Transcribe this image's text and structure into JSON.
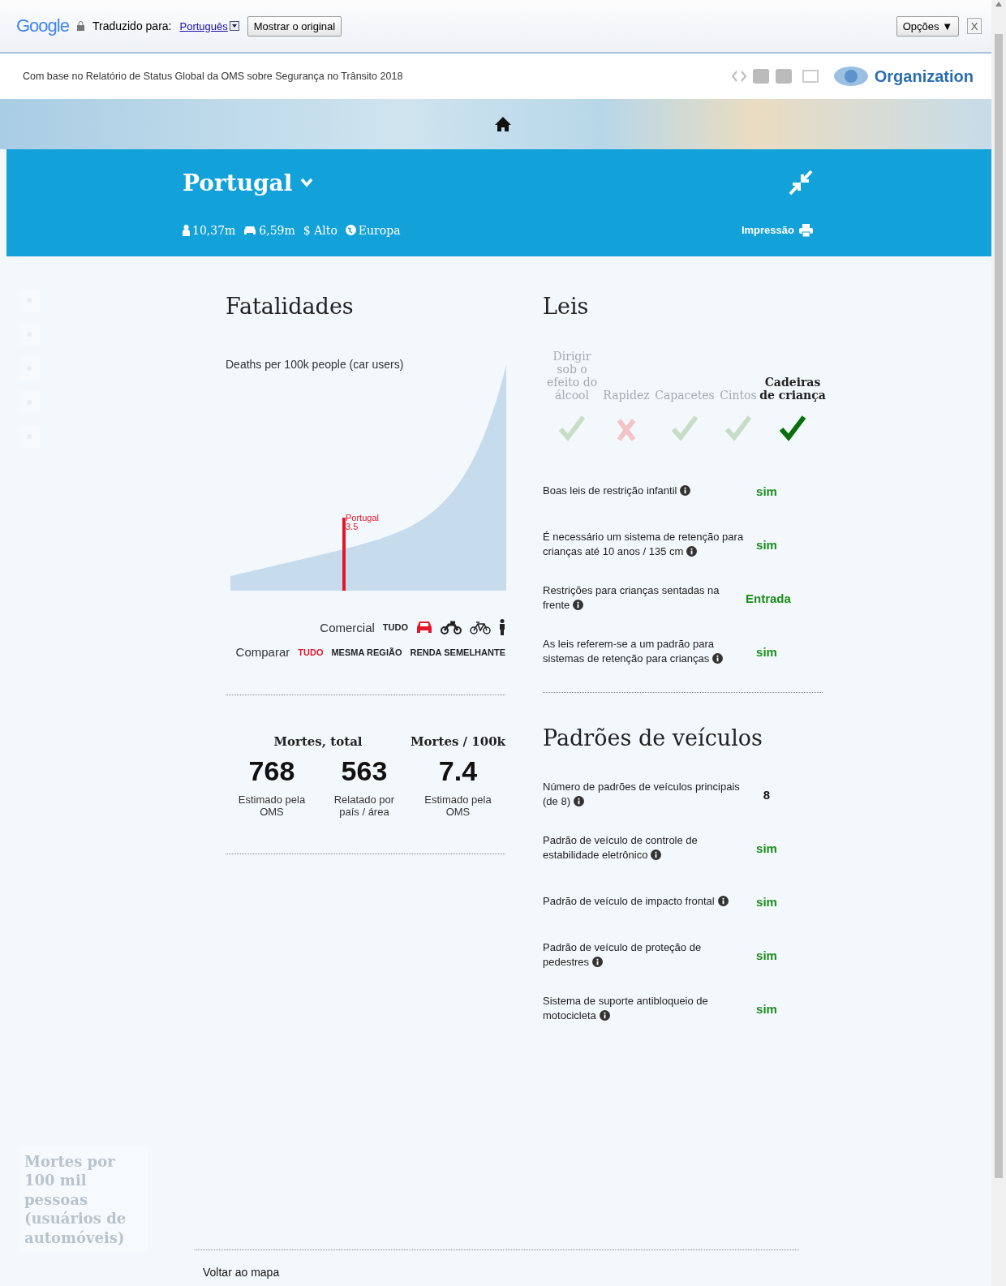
{
  "translate_bar": {
    "logo": "Google",
    "translated_label": "Traduzido para:",
    "language": "Português",
    "show_original_button": "Mostrar o original",
    "options_button": "Opções ▼",
    "close_button": "X"
  },
  "site_header": {
    "source_note": "Com base no Relatório de Status Global da OMS sobre Segurança no Trânsito 2018",
    "org_name": "Organization"
  },
  "country_bar": {
    "country": "Portugal",
    "stats": [
      {
        "kind": "population",
        "text": "10,37m"
      },
      {
        "kind": "vehicles",
        "text": "6,59m"
      },
      {
        "kind": "income",
        "text": "$ Alto"
      },
      {
        "kind": "region",
        "text": "Europa"
      }
    ],
    "print_label": "Impressão"
  },
  "legend": {
    "title": "Mortes por 100 mil pessoas (usuários de automóveis)"
  },
  "fatalities": {
    "title": "Fatalidades",
    "chart_title": "Deaths per 100k people (car users)",
    "marker_label": "Portugal",
    "marker_value": "3.5",
    "mode_label": "Comercial",
    "modes": [
      {
        "kind": "all",
        "label": "TUDO",
        "selected": false
      },
      {
        "kind": "car",
        "selected": true
      },
      {
        "kind": "motorcycle",
        "selected": false
      },
      {
        "kind": "bicycle",
        "selected": false
      },
      {
        "kind": "pedestrian",
        "selected": false
      }
    ],
    "compare_label": "Comparar",
    "compare": [
      {
        "label": "TUDO",
        "selected": true
      },
      {
        "label": "MESMA REGIÃO",
        "selected": false
      },
      {
        "label": "RENDA SEMELHANTE",
        "selected": false
      }
    ],
    "stat_headers": [
      "Mortes, total",
      "Mortes / 100k"
    ],
    "stats": [
      {
        "value": "768",
        "caption": "Estimado pela OMS"
      },
      {
        "value": "563",
        "caption": "Relatado por país / área"
      },
      {
        "value": "7.4",
        "caption": "Estimado pela OMS"
      }
    ]
  },
  "laws": {
    "title": "Leis",
    "categories": [
      {
        "label": "Dirigir sob o efeito do álcool",
        "passed": true,
        "selected": false
      },
      {
        "label": "Rapidez",
        "passed": false,
        "selected": false
      },
      {
        "label": "Capacetes",
        "passed": true,
        "selected": false
      },
      {
        "label": "Cintos",
        "passed": true,
        "selected": false
      },
      {
        "label": "Cadeiras de criança",
        "passed": true,
        "selected": true
      }
    ],
    "rows": [
      {
        "text": "Boas leis de restrição infantil",
        "value": "sim"
      },
      {
        "text": "É necessário um sistema de retenção para crianças até 10 anos / 135 cm",
        "value": "sim"
      },
      {
        "text": "Restrições para crianças sentadas na frente",
        "value": "Entrada"
      },
      {
        "text": "As leis referem-se a um padrão para sistemas de retenção para crianças",
        "value": "sim"
      }
    ]
  },
  "vehicle_standards": {
    "title": "Padrões de veículos",
    "rows": [
      {
        "text": "Número de padrões de veículos principais (de 8)",
        "value": "8",
        "kind": "count"
      },
      {
        "text": "Padrão de veículo de controle de estabilidade eletrônico",
        "value": "sim",
        "kind": "yes"
      },
      {
        "text": "Padrão de veículo de impacto frontal",
        "value": "sim",
        "kind": "yes"
      },
      {
        "text": "Padrão de veículo de proteção de pedestres",
        "value": "sim",
        "kind": "yes"
      },
      {
        "text": "Sistema de suporte antibloqueio de motocicleta",
        "value": "sim",
        "kind": "yes"
      }
    ]
  },
  "back_link": "Voltar ao mapa"
}
